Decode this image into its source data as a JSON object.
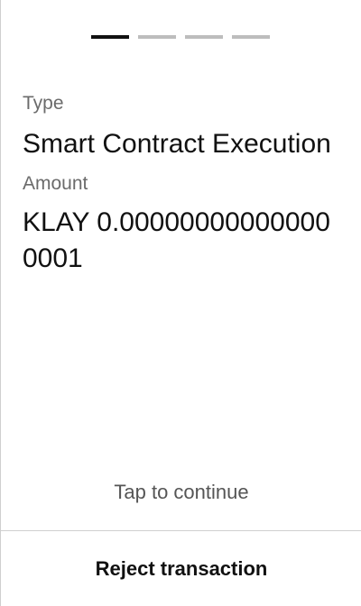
{
  "stepper": {
    "total_steps": 4,
    "current_step": 1
  },
  "details": {
    "type_label": "Type",
    "type_value": "Smart Contract Execution",
    "amount_label": "Amount",
    "amount_value": "KLAY 0.000000000000000001"
  },
  "actions": {
    "tap_hint": "Tap to continue",
    "reject_label": "Reject transaction"
  },
  "colors": {
    "active_step": "#111111",
    "inactive_step": "#bdbdbd",
    "divider": "#cfcfcf"
  }
}
